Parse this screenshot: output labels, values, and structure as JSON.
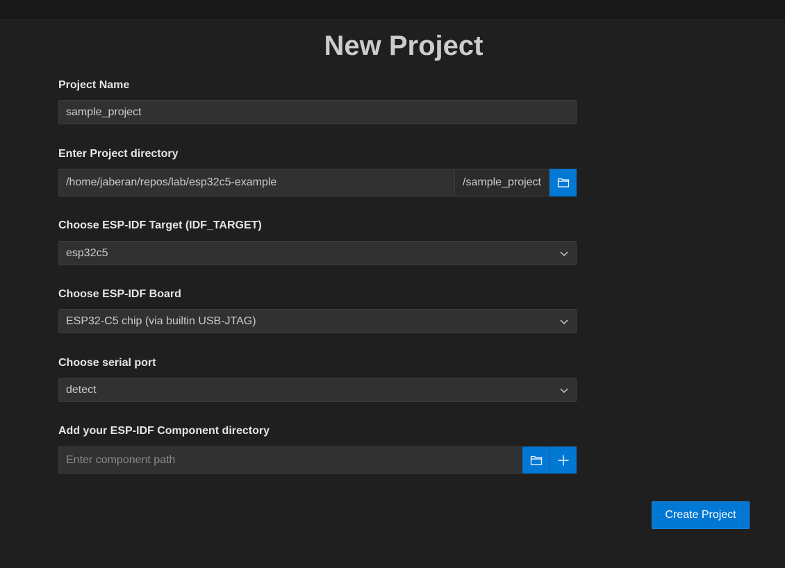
{
  "page": {
    "title": "New Project"
  },
  "fields": {
    "project_name": {
      "label": "Project Name",
      "value": "sample_project"
    },
    "project_directory": {
      "label": "Enter Project directory",
      "value": "/home/jaberan/repos/lab/esp32c5-example",
      "suffix": "/sample_project",
      "browse_icon": "folder-icon"
    },
    "idf_target": {
      "label": "Choose ESP-IDF Target (IDF_TARGET)",
      "selected": "esp32c5"
    },
    "idf_board": {
      "label": "Choose ESP-IDF Board",
      "selected": "ESP32-C5 chip (via builtin USB-JTAG)"
    },
    "serial_port": {
      "label": "Choose serial port",
      "selected": "detect"
    },
    "component_directory": {
      "label": "Add your ESP-IDF Component directory",
      "placeholder": "Enter component path",
      "value": "",
      "browse_icon": "folder-icon",
      "add_icon": "plus-icon"
    }
  },
  "actions": {
    "create_label": "Create Project"
  },
  "colors": {
    "background": "#1f1f1f",
    "input_background": "#313131",
    "accent": "#0078d4",
    "text": "#cccccc"
  }
}
